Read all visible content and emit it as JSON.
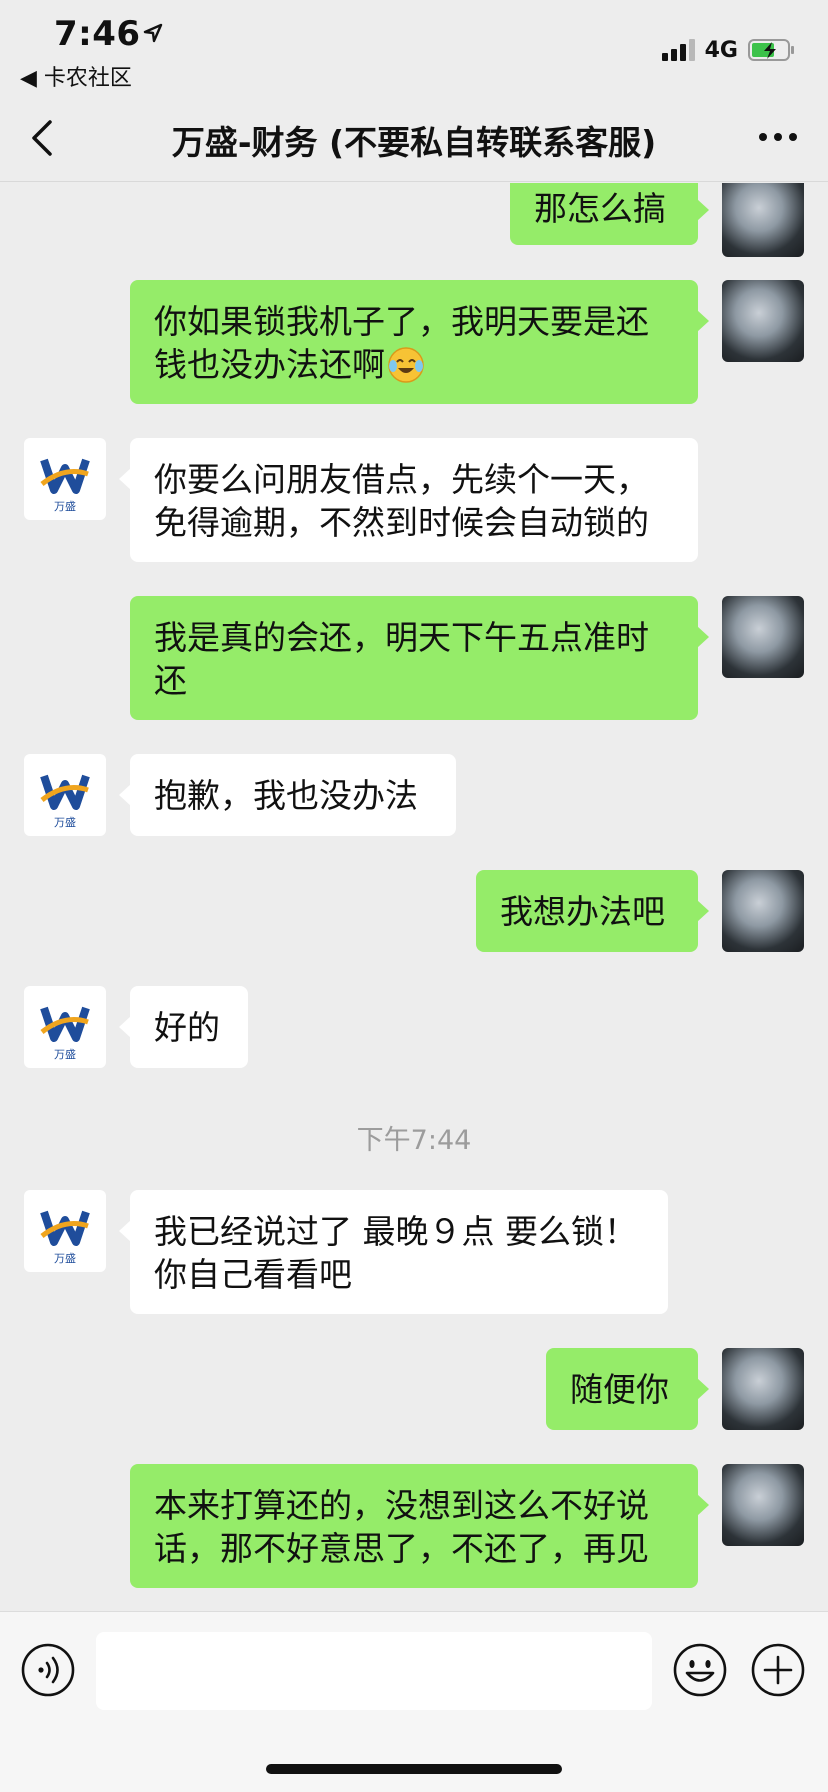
{
  "status_bar": {
    "time": "7:46",
    "back_app": "◀ 卡农社区",
    "network": "4G"
  },
  "navbar": {
    "title": "万盛-财务 (不要私自转联系客服)"
  },
  "avatar_other_brand": "万盛",
  "messages": [
    {
      "from": "me",
      "text": "那怎么搞"
    },
    {
      "from": "me",
      "text": "你如果锁我机子了，我明天要是还钱也没办法还啊",
      "emoji": "laughing-crying-emoji"
    },
    {
      "from": "other",
      "text": "你要么问朋友借点，先续个一天，免得逾期，不然到时候会自动锁的"
    },
    {
      "from": "me",
      "text": "我是真的会还，明天下午五点准时还"
    },
    {
      "from": "other",
      "text": "抱歉，我也没办法"
    },
    {
      "from": "me",
      "text": "我想办法吧"
    },
    {
      "from": "other",
      "text": "好的"
    },
    {
      "from": "other",
      "text": "我已经说过了 最晚９点 要么锁！你自己看看吧"
    },
    {
      "from": "me",
      "text": "随便你"
    },
    {
      "from": "me",
      "text": "本来打算还的，没想到这么不好说话，那不好意思了，不还了，再见"
    }
  ],
  "timestamp": "下午7:44",
  "colors": {
    "background": "#ededed",
    "my_bubble": "#95ec69",
    "other_bubble": "#ffffff",
    "timestamp": "#9c9c9c"
  }
}
